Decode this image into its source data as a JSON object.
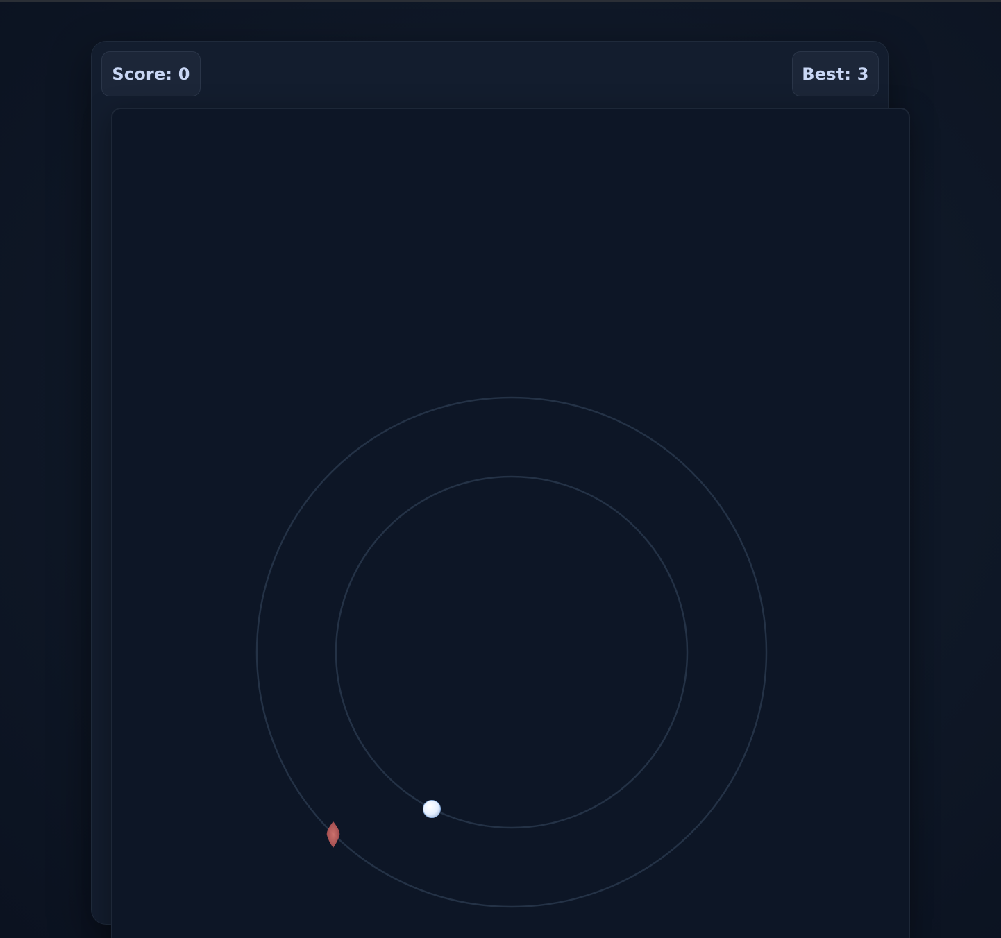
{
  "hud": {
    "score_label": "Score: 0",
    "best_label": "Best: 3"
  },
  "game": {
    "score": 0,
    "best": 3,
    "orbit_color": "#243246",
    "player_color": "#e8f2ff",
    "hazard_color": "#c0605f",
    "background_color": "#0d1626"
  }
}
